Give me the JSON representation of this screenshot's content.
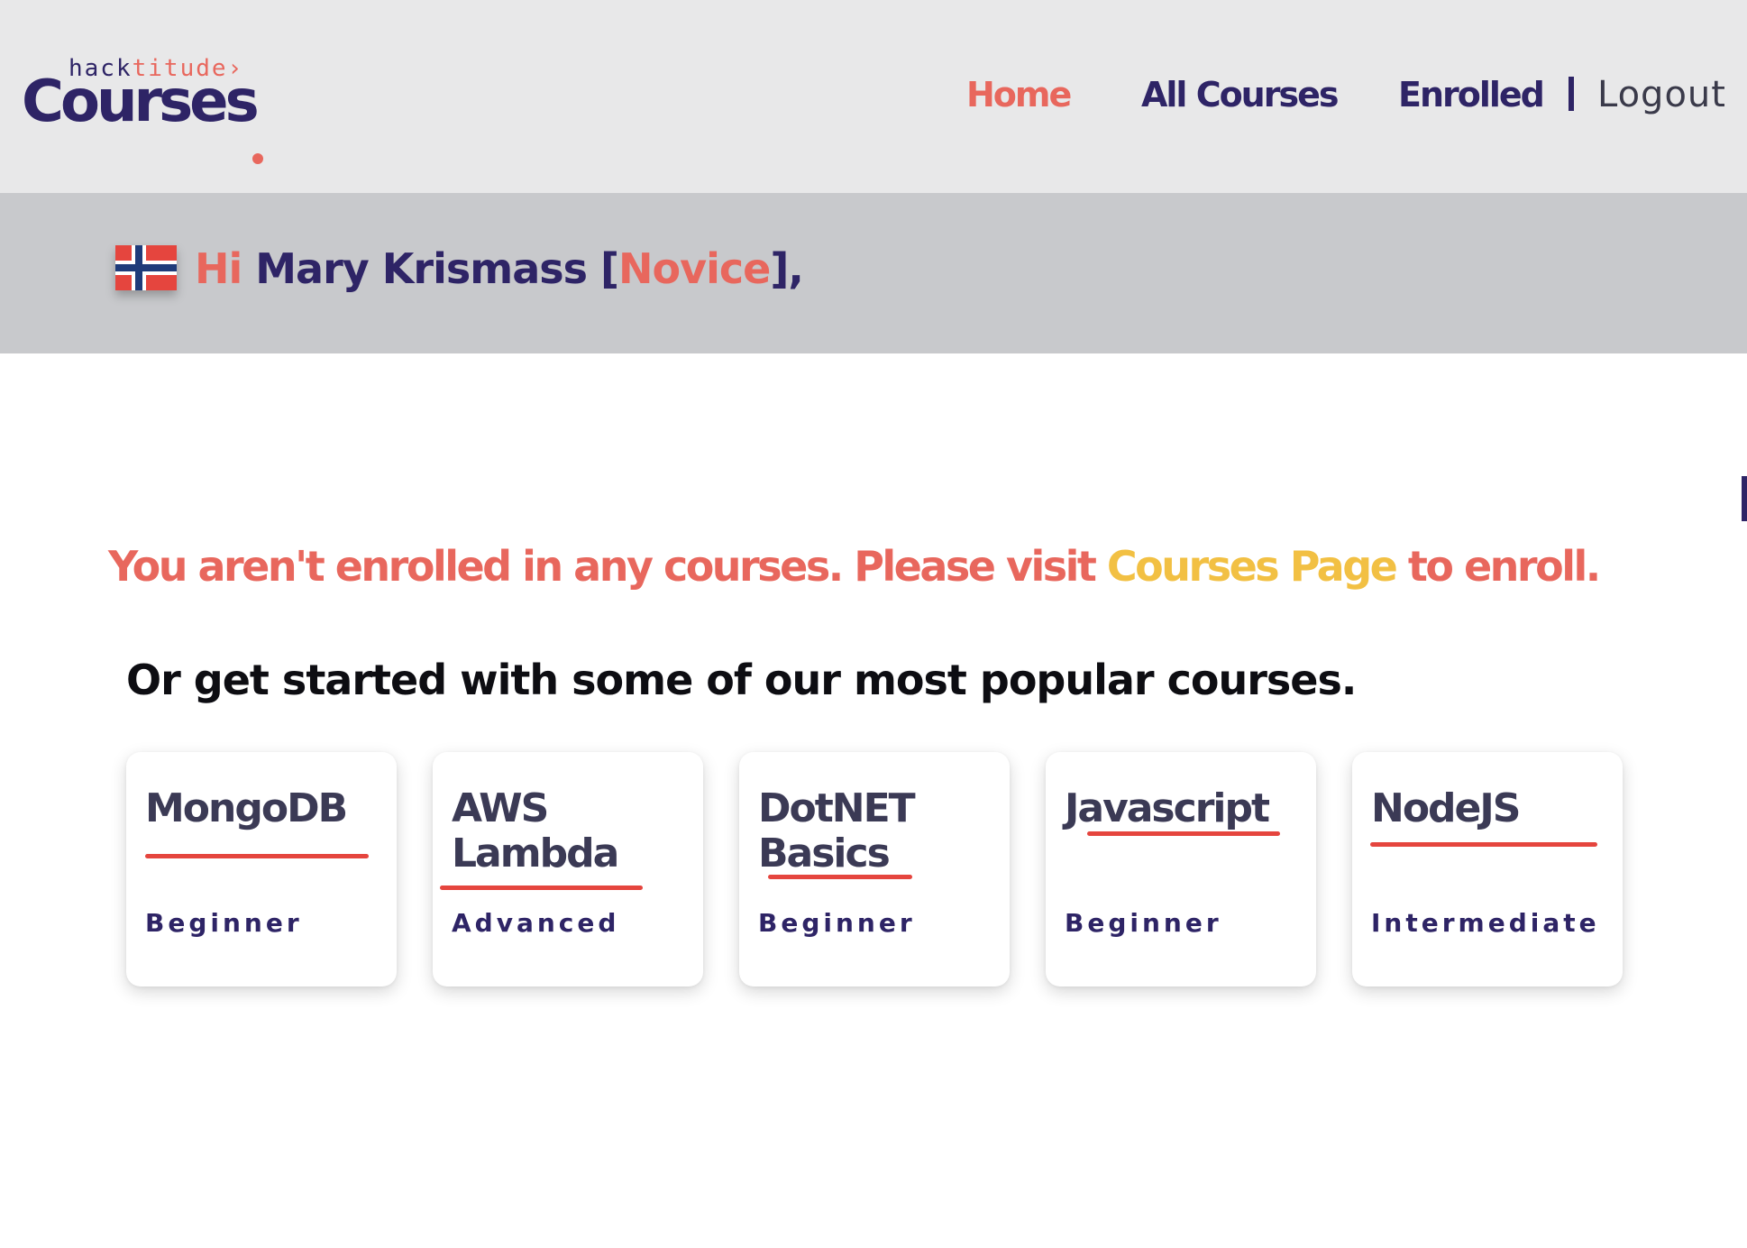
{
  "header": {
    "logo_small_prefix": "hack",
    "logo_small_suffix": "titude›",
    "logo_main": "Courses",
    "nav": {
      "home": "Home",
      "all_courses": "All Courses",
      "enrolled": "Enrolled",
      "logout": "Logout"
    }
  },
  "greeting": {
    "hi": "Hi",
    "name": "Mary Krismass",
    "open_bracket": "[",
    "level": "Novice",
    "close": "],",
    "flag_icon": "norway-flag-icon"
  },
  "main": {
    "notice_before": "You aren't enrolled in any courses. Please visit ",
    "notice_link": "Courses Page",
    "notice_after": " to enroll.",
    "subheading": "Or get started with some of our most popular courses.",
    "courses": [
      {
        "title": "MongoDB",
        "level": "Beginner"
      },
      {
        "title": "AWS Lambda",
        "level": "Advanced"
      },
      {
        "title": "DotNET Basics",
        "level": "Beginner"
      },
      {
        "title": "Javascript",
        "level": "Beginner"
      },
      {
        "title": "NodeJS",
        "level": "Intermediate"
      }
    ]
  },
  "colors": {
    "navy": "#2e2466",
    "coral": "#e8675d",
    "yellow": "#f2c043",
    "underline_red": "#e5453e",
    "header_bg": "#e8e8e9",
    "band_bg": "#c8c9cc"
  }
}
